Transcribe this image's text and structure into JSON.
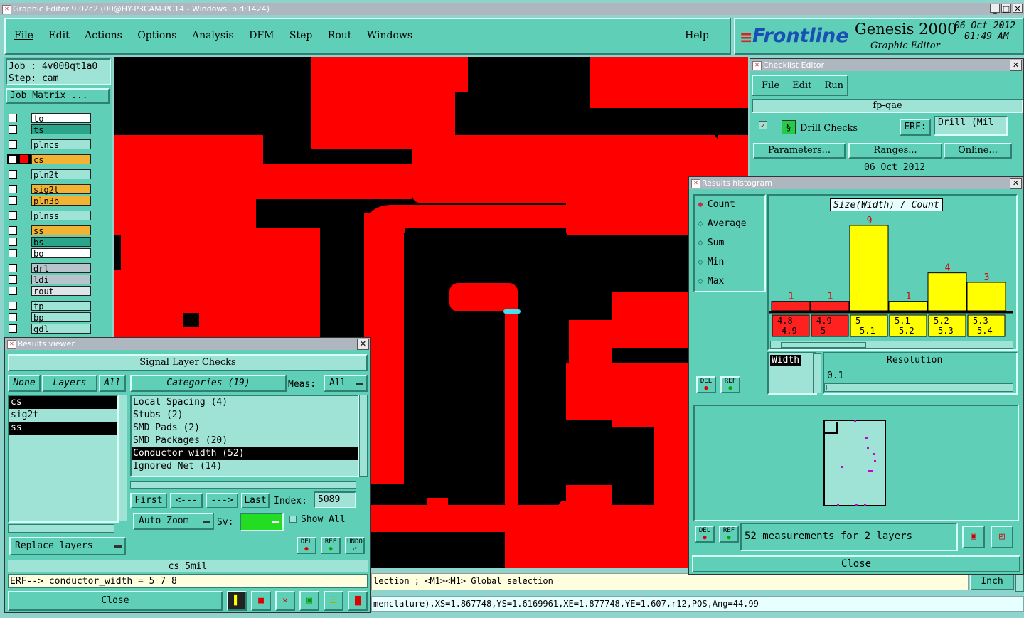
{
  "window": {
    "title": "Graphic Editor 9.02c2 (00@HY-P3CAM-PC14 - Windows, pid:1424)"
  },
  "menu": [
    "File",
    "Edit",
    "Actions",
    "Options",
    "Analysis",
    "DFM",
    "Step",
    "Rout",
    "Windows"
  ],
  "help": "Help",
  "brand": {
    "logo": "Frontline",
    "product": "Genesis 2000",
    "subtitle": "Graphic Editor",
    "date": "06 Oct 2012",
    "time": "01:49 AM"
  },
  "job": {
    "job": "Job : 4v008qt1a0",
    "step": "Step: cam",
    "matrix_btn": "Job Matrix ..."
  },
  "layers": [
    {
      "name": "to",
      "color": "#ffffff",
      "active": false
    },
    {
      "name": "ts",
      "color": "#2aa58a",
      "active": false
    },
    {
      "name": "plncs",
      "color": "#9fe2d6",
      "active": false
    },
    {
      "name": "cs",
      "color": "#f2b233",
      "active": true
    },
    {
      "name": "pln2t",
      "color": "#9fe2d6",
      "active": false
    },
    {
      "name": "sig2t",
      "color": "#f2b233",
      "active": false
    },
    {
      "name": "pln3b",
      "color": "#f2b233",
      "active": false
    },
    {
      "name": "plnss",
      "color": "#9fe2d6",
      "active": false
    },
    {
      "name": "ss",
      "color": "#f2b233",
      "active": false
    },
    {
      "name": "bs",
      "color": "#2aa58a",
      "active": false
    },
    {
      "name": "bo",
      "color": "#ffffff",
      "active": false
    },
    {
      "name": "drl",
      "color": "#b8c4cc",
      "active": false
    },
    {
      "name": "ldi",
      "color": "#b8c4cc",
      "active": false
    },
    {
      "name": "rout",
      "color": "#dfe4e8",
      "active": false
    },
    {
      "name": "tp",
      "color": "#9fe2d6",
      "active": false
    },
    {
      "name": "bp",
      "color": "#9fe2d6",
      "active": false
    },
    {
      "name": "gdl",
      "color": "#9fe2d6",
      "active": false
    }
  ],
  "results_viewer": {
    "title": "Results viewer",
    "header": "Signal Layer Checks",
    "none_btn": "None",
    "layers_btn": "Layers",
    "all_btn": "All",
    "categories_btn": "Categories (19)",
    "meas_label": "Meas:",
    "meas_value": "All",
    "layer_list": [
      "cs",
      "sig2t",
      "ss"
    ],
    "categories": [
      "Local Spacing (4)",
      "Stubs (2)",
      "SMD Pads (2)",
      "SMD Packages (20)",
      "Conductor width (52)",
      "Ignored Net (14)"
    ],
    "first": "First",
    "prev": "<---",
    "next": "--->",
    "last": "Last",
    "index_label": "Index:",
    "index_value": "5089",
    "auto_zoom": "Auto Zoom",
    "sv_label": "Sv:",
    "show_all": "Show All",
    "replace_layers": "Replace layers",
    "del": "DEL",
    "ref": "REF",
    "undo": "UNDO",
    "status": "cs 5mil",
    "erf": "ERF--> conductor_width = 5 7 8",
    "close": "Close"
  },
  "checklist": {
    "title": "Checklist Editor",
    "menu": [
      "File",
      "Edit",
      "Run"
    ],
    "name": "fp-qae",
    "drill_checks": "Drill Checks",
    "erf_label": "ERF:",
    "erf_value": "Drill (Mil",
    "parameters": "Parameters...",
    "ranges": "Ranges...",
    "online": "Online...",
    "date": "06 Oct 2012"
  },
  "histogram": {
    "title": "Results histogram",
    "modes": [
      "Count",
      "Average",
      "Sum",
      "Min",
      "Max"
    ],
    "selected_mode": "Count",
    "chart_title": "Size(Width) / Count",
    "width_label": "Width",
    "resolution_label": "Resolution",
    "resolution_value": "0.1",
    "del": "DEL",
    "ref": "REF",
    "summary": "52 measurements for 2 layers",
    "close": "Close"
  },
  "chart_data": {
    "type": "bar",
    "title": "Size(Width) / Count",
    "categories": [
      "4.8-4.9",
      "4.9-5",
      "5-5.1",
      "5.1-5.2",
      "5.2-5.3",
      "5.3-5.4"
    ],
    "values": [
      1,
      1,
      9,
      1,
      4,
      3
    ],
    "colors": [
      "#ff2020",
      "#ff2020",
      "#ffff00",
      "#ffff00",
      "#ffff00",
      "#ffff00"
    ],
    "ylim": [
      0,
      9
    ]
  },
  "status_bar": {
    "selection": "lection ; <M1><M1> Global selection",
    "units": "Inch",
    "coords": "menclature),XS=1.867748,YS=1.6169961,XE=1.877748,YE=1.607,r12,POS,Ang=44.99"
  }
}
